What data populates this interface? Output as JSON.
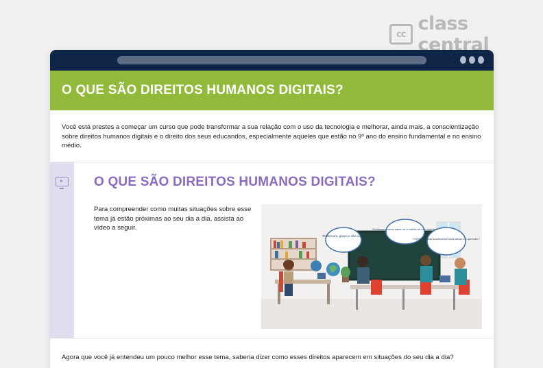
{
  "brand": {
    "mark": "cc",
    "name": "class central"
  },
  "colors": {
    "hero": "#92ba3a",
    "browser_bar": "#0f2546",
    "section_title": "#8a6bc0",
    "rail": "#e2dcef"
  },
  "hero": {
    "title": "O QUE SÃO DIREITOS HUMANOS DIGITAIS?"
  },
  "intro": {
    "text": "Você está prestes a começar um curso que pode transformar a sua relação com o uso da tecnologia e melhorar, ainda mais, a conscientização sobre direitos humanos digitais e o direito dos seus educandos, especialmente aqueles que estão no 9º ano do ensino fundamental e no ensino médio."
  },
  "section": {
    "icon": "video-icon",
    "title": "O QUE SÃO DIREITOS HUMANOS DIGITAIS?",
    "text": "Para compreender como muitas situações sobre esse tema já estão próximas ao seu dia a dia, assista ao vídeo a seguir.",
    "bubbles": [
      "Professora, gravei e vão expor",
      "Professora, como saber se a notícia de ódio ocorreu?",
      "Professora, está acontecendo muito abuso e o que fazer?"
    ]
  },
  "bottom": {
    "text": "Agora que você já entendeu um pouco melhor esse tema, saberia dizer como esses direitos aparecem em situações do seu dia a dia?"
  }
}
